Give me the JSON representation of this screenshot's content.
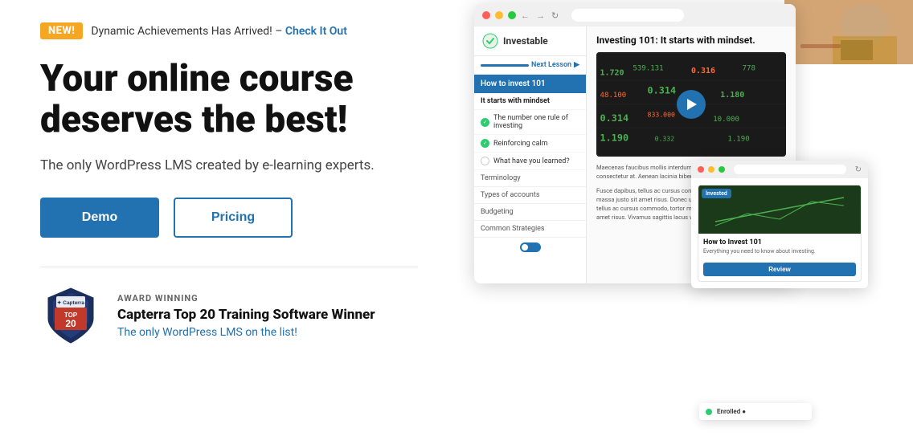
{
  "announcement": {
    "badge": "NEW!",
    "text": "Dynamic Achievements Has Arrived! –",
    "link_text": "Check It Out",
    "link_href": "#"
  },
  "hero": {
    "headline": "Your online course deserves the best!",
    "subtext": "The only WordPress LMS created by e-learning experts."
  },
  "buttons": {
    "demo_label": "Demo",
    "pricing_label": "Pricing"
  },
  "award": {
    "category": "AWARD WINNING",
    "title": "Capterra Top 20 Training Software Winner",
    "description": "The only WordPress LMS on the list!"
  },
  "lms_demo": {
    "logo_text": "Investable",
    "next_lesson": "Next Lesson",
    "module_title": "How to invest 101",
    "lessons": [
      {
        "label": "It starts with mindset",
        "status": "current"
      },
      {
        "label": "The number one rule of investing",
        "status": "done"
      },
      {
        "label": "Reinforcing calm",
        "status": "done"
      },
      {
        "label": "What have you learned?",
        "status": "none"
      },
      {
        "label": "Terminology",
        "status": "section"
      },
      {
        "label": "Types of accounts",
        "status": "section"
      },
      {
        "label": "Budgeting",
        "status": "section"
      },
      {
        "label": "Common Strategies",
        "status": "section"
      }
    ],
    "content_title": "Investing 101: It starts with mindset.",
    "body_text_1": "Maecenas faucibus mollis interdum. Praesent commodo cursus ma consectetur at. Aenean lacinia bibendum nulla sed consectetur.",
    "body_text_2": "Fusce dapibus, tellus ac cursus commodo, tortor mauris condiment massa justo sit amet risus. Donec ullamcorper nulla non metus auct tellus ac cursus commodo, tortor mauris condimentum nibh, ut fer amet risus. Vivamus sagittis lacus vel augue laoreet rutrum faucibus"
  },
  "course_card": {
    "badge": "Invested",
    "title": "How to Invest 101",
    "subtitle": "Everything you need to know about investing.",
    "button_label": "Review"
  },
  "enrolled_badge": {
    "text": "Enrolled ●"
  },
  "stock_numbers": [
    "1.720",
    "539",
    "131",
    "0.316",
    "48.100",
    "0.314",
    "1.190",
    "778",
    "0.314",
    "833.000",
    "10.000",
    "0.332",
    "1.190"
  ]
}
